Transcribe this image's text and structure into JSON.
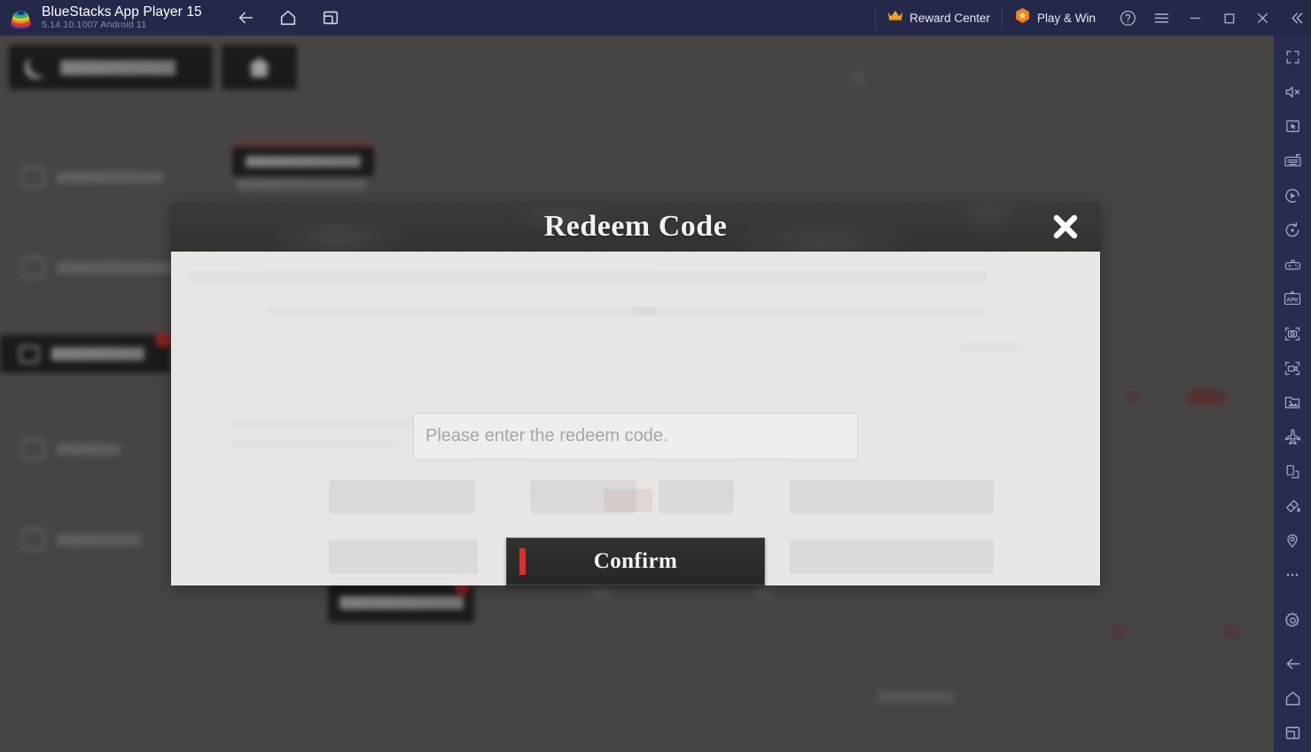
{
  "titlebar": {
    "app_name": "BlueStacks App Player 15",
    "version_line": "5.14.10.1007  Android 11",
    "logo_icon": "bluestacks-logo",
    "nav": [
      {
        "name": "back",
        "icon": "arrow-left-icon"
      },
      {
        "name": "home",
        "icon": "home-icon"
      },
      {
        "name": "recents",
        "icon": "recent-apps-icon"
      }
    ],
    "reward_center": {
      "label": "Reward Center",
      "icon": "crown-icon"
    },
    "play_and_win": {
      "label": "Play & Win",
      "icon": "star-badge-icon"
    },
    "window_icons": [
      {
        "name": "help",
        "icon": "help-circle-icon"
      },
      {
        "name": "menu",
        "icon": "hamburger-menu-icon"
      },
      {
        "name": "minimize",
        "icon": "minimize-icon"
      },
      {
        "name": "maximize",
        "icon": "maximize-icon"
      },
      {
        "name": "close",
        "icon": "close-icon"
      },
      {
        "name": "collapse-sidebar",
        "icon": "chevron-double-left-icon"
      }
    ]
  },
  "sidebar": {
    "items": [
      {
        "name": "fullscreen",
        "icon": "fullscreen-icon"
      },
      {
        "name": "mute",
        "icon": "speaker-mute-icon"
      },
      {
        "name": "cursor-control",
        "icon": "cursor-screen-icon"
      },
      {
        "name": "game-controls",
        "icon": "keyboard-controls-icon"
      },
      {
        "name": "macro-recorder",
        "icon": "macro-play-icon"
      },
      {
        "name": "rotate",
        "icon": "rotate-icon"
      },
      {
        "name": "gamepad",
        "icon": "gamepad-icon"
      },
      {
        "name": "install-apk",
        "icon": "apk-install-icon"
      },
      {
        "name": "screenshot",
        "icon": "camera-icon"
      },
      {
        "name": "record-screen",
        "icon": "video-record-icon"
      },
      {
        "name": "media-manager",
        "icon": "media-gallery-icon"
      },
      {
        "name": "airplane-mode",
        "icon": "airplane-icon"
      },
      {
        "name": "multi-instance",
        "icon": "multi-instance-icon"
      },
      {
        "name": "eco-mode",
        "icon": "eco-paint-icon"
      },
      {
        "name": "location",
        "icon": "location-pin-icon"
      },
      {
        "name": "more-options",
        "icon": "ellipsis-icon"
      },
      {
        "name": "settings",
        "icon": "gear-icon"
      },
      {
        "name": "android-back",
        "icon": "arrow-left-icon"
      },
      {
        "name": "android-home",
        "icon": "home-icon"
      },
      {
        "name": "android-recents",
        "icon": "recent-apps-icon"
      }
    ]
  },
  "modal": {
    "title": "Redeem Code",
    "close_icon": "close-x-icon",
    "input": {
      "placeholder": "Please enter the redeem code.",
      "value": ""
    },
    "confirm_label": "Confirm",
    "accent_color": "#d8302e"
  },
  "colors": {
    "titlebar_bg": "#252949",
    "sidebar_bg": "#282c4e",
    "modal_header_bg": "#363636",
    "modal_body_bg": "#f0efed",
    "button_bg": "#2b2b2b",
    "red_accent": "#d8302e",
    "background_dim": "#565452"
  }
}
